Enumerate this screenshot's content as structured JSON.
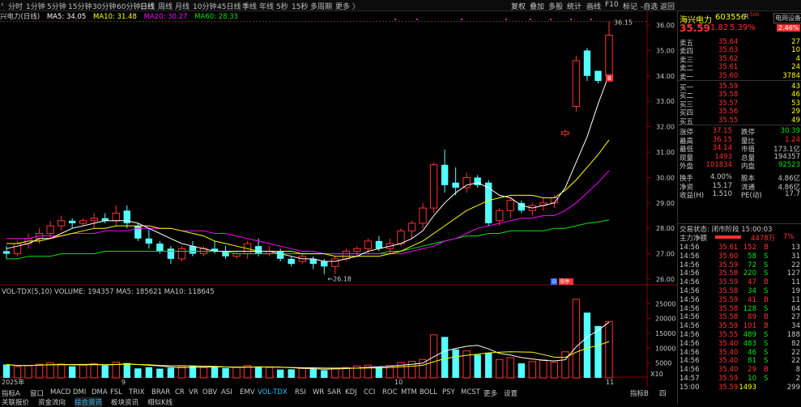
{
  "toolbar": {
    "back_label": "‹",
    "periods": [
      {
        "label": "分时",
        "active": false
      },
      {
        "label": "1分钟",
        "active": false
      },
      {
        "label": "5分钟",
        "active": false
      },
      {
        "label": "15分钟",
        "active": false
      },
      {
        "label": "30分钟",
        "active": false
      },
      {
        "label": "60分钟",
        "active": false
      },
      {
        "label": "日线",
        "active": true
      },
      {
        "label": "周线",
        "active": false
      },
      {
        "label": "月线",
        "active": false
      },
      {
        "label": "10分钟",
        "active": false
      },
      {
        "label": "45日线",
        "active": false
      },
      {
        "label": "季线",
        "active": false
      },
      {
        "label": "年线",
        "active": false
      },
      {
        "label": "5秒",
        "active": false
      },
      {
        "label": "15秒",
        "active": false
      },
      {
        "label": "多周期",
        "active": false
      },
      {
        "label": "更多 〉",
        "active": false
      }
    ],
    "right_menu": [
      "复权",
      "叠加",
      "多股",
      "统计",
      "画线",
      "F10",
      "标记",
      "-自选",
      "返回"
    ]
  },
  "legend": {
    "title": "兴电力(日线)",
    "ma5": "MA5: 34.05",
    "ma10": "MA10: 31.48",
    "ma20": "MA20: 30.27",
    "ma60": "MA60: 28.33"
  },
  "colors": {
    "up": "#ff3232",
    "down": "#54ffff",
    "ma5": "#ffffff",
    "ma10": "#ffff00",
    "ma20": "#ff00ff",
    "ma60": "#00e600",
    "accent": "#2ec2ff"
  },
  "price_axis": {
    "ticks": [
      "36.00",
      "35.00",
      "34.00",
      "33.00",
      "32.00",
      "31.00",
      "30.00",
      "29.00",
      "28.00",
      "27.00",
      "26.00"
    ]
  },
  "annotations": {
    "high": "36.15",
    "low": "26.18",
    "badge_b": "B",
    "badge_d": "D",
    "badge_text": "涨停"
  },
  "volume": {
    "legend": "VOL-TDX(5,10)  VOLUME: 194357  MA5: 185621  MA10: 118645",
    "ticks": [
      "25000",
      "20000",
      "15000",
      "10000",
      "5000"
    ],
    "unit": "X10",
    "date_labels": [
      "2025年",
      "9",
      "10",
      "11"
    ]
  },
  "chart_data": {
    "type": "candlestick",
    "ylim": [
      26,
      36.2
    ],
    "ohlc": [
      [
        27.1,
        27.3,
        26.8,
        27.0
      ],
      [
        27.0,
        27.5,
        26.9,
        27.4
      ],
      [
        27.4,
        27.8,
        27.2,
        27.6
      ],
      [
        27.6,
        28.0,
        27.4,
        27.8
      ],
      [
        27.8,
        28.3,
        27.6,
        28.1
      ],
      [
        28.1,
        28.5,
        27.9,
        28.3
      ],
      [
        28.3,
        28.4,
        28.0,
        28.2
      ],
      [
        28.2,
        28.4,
        28.1,
        28.3
      ],
      [
        28.3,
        28.6,
        28.0,
        28.4
      ],
      [
        28.4,
        28.6,
        28.2,
        28.3
      ],
      [
        28.3,
        28.9,
        28.1,
        28.6
      ],
      [
        28.7,
        28.9,
        28.0,
        28.2
      ],
      [
        28.1,
        28.2,
        27.5,
        27.6
      ],
      [
        27.6,
        28.0,
        27.2,
        27.4
      ],
      [
        27.4,
        27.5,
        27.0,
        27.1
      ],
      [
        27.2,
        27.3,
        26.6,
        26.8
      ],
      [
        26.8,
        27.3,
        26.7,
        27.2
      ],
      [
        27.3,
        27.5,
        26.9,
        27.0
      ],
      [
        27.0,
        27.3,
        26.9,
        27.2
      ],
      [
        27.2,
        27.5,
        27.0,
        27.1
      ],
      [
        27.1,
        27.3,
        26.8,
        26.9
      ],
      [
        26.9,
        27.1,
        26.8,
        27.0
      ],
      [
        27.0,
        27.5,
        26.8,
        27.4
      ],
      [
        27.3,
        27.6,
        26.9,
        27.0
      ],
      [
        27.0,
        27.3,
        26.9,
        27.1
      ],
      [
        27.1,
        27.2,
        26.7,
        26.8
      ],
      [
        26.8,
        26.9,
        26.5,
        26.6
      ],
      [
        26.7,
        27.0,
        26.6,
        26.9
      ],
      [
        26.8,
        26.9,
        26.4,
        26.6
      ],
      [
        26.7,
        26.8,
        26.2,
        26.5
      ],
      [
        26.5,
        26.9,
        26.2,
        26.8
      ],
      [
        26.8,
        27.2,
        26.7,
        27.1
      ],
      [
        27.1,
        27.3,
        26.9,
        27.2
      ],
      [
        27.2,
        27.6,
        27.0,
        27.5
      ],
      [
        27.5,
        27.7,
        27.1,
        27.2
      ],
      [
        27.2,
        27.6,
        27.0,
        27.4
      ],
      [
        27.4,
        28.0,
        27.3,
        27.9
      ],
      [
        27.9,
        28.3,
        27.6,
        28.2
      ],
      [
        28.2,
        29.0,
        28.0,
        28.8
      ],
      [
        28.8,
        30.6,
        28.6,
        30.5
      ],
      [
        30.5,
        31.1,
        29.4,
        29.7
      ],
      [
        29.8,
        30.4,
        29.3,
        29.6
      ],
      [
        29.6,
        30.2,
        29.4,
        30.0
      ],
      [
        30.0,
        30.1,
        29.6,
        29.7
      ],
      [
        29.8,
        29.9,
        28.1,
        28.2
      ],
      [
        28.3,
        28.8,
        28.1,
        28.7
      ],
      [
        28.7,
        29.2,
        28.4,
        29.1
      ],
      [
        29.0,
        29.1,
        28.6,
        28.7
      ],
      [
        28.7,
        29.0,
        28.5,
        28.9
      ],
      [
        28.9,
        29.2,
        28.7,
        29.0
      ],
      [
        29.0,
        29.3,
        28.8,
        29.2
      ],
      [
        31.7,
        31.9,
        31.6,
        31.8
      ],
      [
        32.8,
        34.8,
        32.6,
        34.6
      ],
      [
        35.0,
        35.1,
        33.8,
        34.0
      ],
      [
        34.2,
        34.2,
        33.7,
        33.8
      ],
      [
        34.0,
        36.15,
        34.0,
        35.6
      ]
    ],
    "volumes": [
      4500,
      3800,
      4200,
      4600,
      5100,
      4700,
      3900,
      4300,
      4800,
      4200,
      5300,
      5000,
      3200,
      3600,
      3100,
      3400,
      3900,
      4000,
      3500,
      3700,
      3300,
      3600,
      4200,
      3800,
      3500,
      2800,
      2900,
      3200,
      3100,
      2600,
      3300,
      3500,
      4000,
      4300,
      3700,
      4100,
      5200,
      5600,
      6200,
      14500,
      13800,
      9600,
      9100,
      7800,
      8500,
      6200,
      6800,
      4900,
      5500,
      6100,
      5300,
      8800,
      26500,
      22000,
      17500,
      19000
    ],
    "ma5": [
      27.2,
      27.3,
      27.4,
      27.6,
      27.6,
      27.8,
      28.0,
      28.1,
      28.2,
      28.3,
      28.3,
      28.3,
      28.2,
      28.0,
      27.8,
      27.6,
      27.4,
      27.3,
      27.2,
      27.1,
      27.1,
      27.1,
      27.1,
      27.1,
      27.1,
      27.0,
      26.9,
      26.8,
      26.8,
      26.7,
      26.7,
      26.8,
      26.9,
      27.1,
      27.2,
      27.3,
      27.4,
      27.6,
      27.9,
      28.5,
      29.0,
      29.4,
      29.7,
      29.8,
      29.6,
      29.3,
      29.2,
      28.9,
      28.8,
      28.9,
      29.0,
      29.6,
      30.6,
      31.6,
      32.9,
      34.05
    ],
    "ma10": [
      27.4,
      27.4,
      27.5,
      27.5,
      27.6,
      27.7,
      27.8,
      27.9,
      28.0,
      28.0,
      28.1,
      28.1,
      28.1,
      28.1,
      28.0,
      28.0,
      27.9,
      27.8,
      27.7,
      27.5,
      27.4,
      27.3,
      27.2,
      27.1,
      27.1,
      27.1,
      27.1,
      27.0,
      27.0,
      27.0,
      26.9,
      26.9,
      26.9,
      26.9,
      26.9,
      27.0,
      27.1,
      27.3,
      27.5,
      27.8,
      28.1,
      28.4,
      28.7,
      28.9,
      29.1,
      29.2,
      29.3,
      29.3,
      29.3,
      29.2,
      29.2,
      29.5,
      29.9,
      30.4,
      30.9,
      31.48
    ],
    "ma20": [
      27.6,
      27.6,
      27.6,
      27.7,
      27.7,
      27.7,
      27.8,
      27.8,
      27.8,
      27.9,
      27.9,
      27.9,
      28.0,
      28.0,
      28.0,
      28.0,
      27.9,
      27.9,
      27.9,
      27.8,
      27.8,
      27.7,
      27.6,
      27.5,
      27.4,
      27.3,
      27.2,
      27.1,
      27.1,
      27.0,
      27.0,
      27.0,
      27.0,
      27.0,
      27.0,
      27.0,
      27.0,
      27.1,
      27.2,
      27.3,
      27.5,
      27.6,
      27.8,
      28.0,
      28.1,
      28.2,
      28.3,
      28.4,
      28.4,
      28.5,
      28.5,
      28.7,
      29.0,
      29.4,
      29.8,
      30.27
    ],
    "ma60": [
      26.8,
      26.8,
      26.9,
      26.9,
      26.9,
      27.0,
      27.0,
      27.0,
      27.0,
      27.1,
      27.1,
      27.1,
      27.1,
      27.1,
      27.1,
      27.1,
      27.1,
      27.1,
      27.1,
      27.1,
      27.1,
      27.0,
      27.0,
      27.0,
      27.0,
      27.0,
      27.0,
      27.0,
      27.0,
      27.0,
      27.0,
      27.0,
      27.0,
      27.0,
      27.0,
      27.1,
      27.1,
      27.2,
      27.3,
      27.4,
      27.5,
      27.6,
      27.7,
      27.7,
      27.8,
      27.8,
      27.9,
      27.9,
      27.9,
      27.9,
      28.0,
      28.0,
      28.1,
      28.2,
      28.25,
      28.33
    ]
  },
  "sidebar": {
    "stock_name": "海兴电力",
    "stock_code": "603556",
    "badge": "R",
    "sub_badge": "500",
    "deal_btn": "电网设备",
    "price": "35.59",
    "change": "1.82",
    "pct": "5.39%",
    "side_pct": "2.46%",
    "asks": [
      {
        "label": "卖五",
        "price": "35.64",
        "vol": "27"
      },
      {
        "label": "卖四",
        "price": "35.63",
        "vol": "10"
      },
      {
        "label": "卖三",
        "price": "35.62",
        "vol": "4"
      },
      {
        "label": "卖二",
        "price": "35.61",
        "vol": "24"
      },
      {
        "label": "卖一",
        "price": "35.60",
        "vol": "3784"
      }
    ],
    "bids": [
      {
        "label": "买一",
        "price": "35.59",
        "vol": "43"
      },
      {
        "label": "买二",
        "price": "35.58",
        "vol": "46"
      },
      {
        "label": "买三",
        "price": "35.57",
        "vol": "53"
      },
      {
        "label": "买四",
        "price": "35.56",
        "vol": "29"
      },
      {
        "label": "买五",
        "price": "35.55",
        "vol": "49"
      }
    ],
    "stats": [
      {
        "l1": "涨停",
        "v1": "37.15",
        "l2": "跌停",
        "v2": "30.39",
        "c1": "#ff3232",
        "c2": "#00e600"
      },
      {
        "l1": "最高",
        "v1": "36.15",
        "l2": "量比",
        "v2": "1.24",
        "c1": "#ff3232",
        "c2": "#ff3232"
      },
      {
        "l1": "最低",
        "v1": "34.14",
        "l2": "市值",
        "v2": "173.1亿",
        "c1": "#ff3232",
        "c2": "#c8c8c8"
      },
      {
        "l1": "现量",
        "v1": "1493",
        "l2": "总量",
        "v2": "194357",
        "c1": "#ff3232",
        "c2": "#c8c8c8"
      },
      {
        "l1": "外盘",
        "v1": "101834",
        "l2": "内盘",
        "v2": "92523",
        "c1": "#ff3232",
        "c2": "#00e600"
      },
      {
        "l1": "换手",
        "v1": "4.00%",
        "l2": "股本",
        "v2": "4.86亿",
        "c1": "#c8c8c8",
        "c2": "#c8c8c8"
      },
      {
        "l1": "净资",
        "v1": "15.17",
        "l2": "流通",
        "v2": "4.86亿",
        "c1": "#c8c8c8",
        "c2": "#c8c8c8"
      },
      {
        "l1": "收益(H)",
        "v1": "1.510",
        "l2": "PE(动)",
        "v2": "17.7",
        "c1": "#c8c8c8",
        "c2": "#c8c8c8"
      }
    ],
    "status": "交易状态: 闭市阶段 15:00:03",
    "net_flow_label": "主力净额",
    "net_flow_value": "4478万",
    "net_flow_pct": "7%",
    "ticks": [
      {
        "t": "14:56",
        "p": "35.61",
        "v": "152",
        "bs": "B",
        "n": "13"
      },
      {
        "t": "14:56",
        "p": "35.60",
        "v": "58",
        "bs": "S",
        "n": "31"
      },
      {
        "t": "14:56",
        "p": "35.59",
        "v": "72",
        "bs": "S",
        "n": "22"
      },
      {
        "t": "14:56",
        "p": "35.58",
        "v": "220",
        "bs": "S",
        "n": "127"
      },
      {
        "t": "14:56",
        "p": "35.59",
        "v": "47",
        "bs": "B",
        "n": "11"
      },
      {
        "t": "14:56",
        "p": "35.58",
        "v": "34",
        "bs": "S",
        "n": "19"
      },
      {
        "t": "14:56",
        "p": "35.59",
        "v": "41",
        "bs": "B",
        "n": "11"
      },
      {
        "t": "14:56",
        "p": "35.58",
        "v": "128",
        "bs": "S",
        "n": "64"
      },
      {
        "t": "14:56",
        "p": "35.58",
        "v": "89",
        "bs": "B",
        "n": "27"
      },
      {
        "t": "14:56",
        "p": "35.59",
        "v": "101",
        "bs": "B",
        "n": "34"
      },
      {
        "t": "14:56",
        "p": "35.55",
        "v": "489",
        "bs": "S",
        "n": "188"
      },
      {
        "t": "14:56",
        "p": "35.40",
        "v": "483",
        "bs": "S",
        "n": "82"
      },
      {
        "t": "14:56",
        "p": "35.40",
        "v": "46",
        "bs": "S",
        "n": "22"
      },
      {
        "t": "14:56",
        "p": "35.40",
        "v": "81",
        "bs": "S",
        "n": "22"
      },
      {
        "t": "14:56",
        "p": "35.40",
        "v": "29",
        "bs": "B",
        "n": "8"
      },
      {
        "t": "14:57",
        "p": "35.59",
        "v": "10",
        "bs": "S",
        "n": "2"
      },
      {
        "t": "15:00",
        "p": "35.59",
        "v": "1493",
        "bs": "",
        "n": "299"
      }
    ]
  },
  "bottom": {
    "indicator_tabs": [
      "指标A",
      "窗口",
      "MACD",
      "DMI",
      "DMA",
      "FSL",
      "TRIX",
      "BRAR",
      "CR",
      "VR",
      "OBV",
      "ASI",
      "EMV",
      "VOL-TDX",
      "RSI",
      "WR",
      "SAR",
      "KDJ",
      "CCI",
      "ROC",
      "MTM",
      "BOLL",
      "PSY",
      "MCST",
      "更多",
      "设置"
    ],
    "selected_indicator": "VOL-TDX",
    "info_tabs": [
      "关联报价",
      "资金流向",
      "综合资讯",
      "板块资讯",
      "相似K线"
    ],
    "selected_info": "综合资讯",
    "right_tab": "指标B",
    "right_tab2": "四"
  }
}
